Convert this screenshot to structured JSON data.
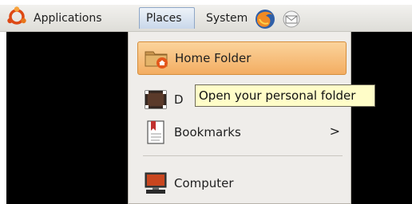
{
  "panel": {
    "applications_label": "Applications",
    "places_label": "Places",
    "system_label": "System",
    "logo_icon": "ubuntu-logo-icon",
    "browser_icon": "firefox-icon",
    "mail_icon": "mail-icon"
  },
  "places_menu": {
    "items": [
      {
        "label": "Home Folder",
        "icon": "home-folder-icon",
        "active": true
      },
      {
        "label": "D",
        "icon": "desktop-icon",
        "active": false
      },
      {
        "label": "Bookmarks",
        "icon": "bookmarks-icon",
        "active": false,
        "submenu_arrow": ">"
      },
      {
        "label": "Computer",
        "icon": "computer-icon",
        "active": false
      }
    ]
  },
  "tooltip": {
    "text": "Open your personal folder"
  },
  "colors": {
    "highlight": "#f3ad62",
    "tooltip_bg": "#fffdc8",
    "panel_bg": "#e8e7e3",
    "menu_bg": "#efedea"
  }
}
